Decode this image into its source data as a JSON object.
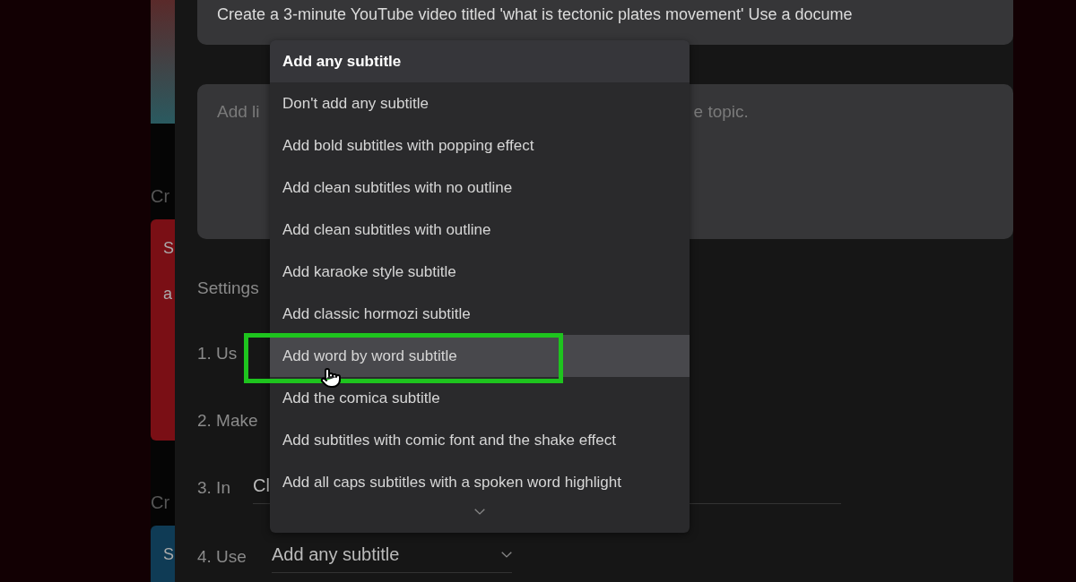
{
  "background_page": {
    "sidebar_texts": [
      "Cr",
      "Cr"
    ],
    "red_card": [
      "S",
      "a"
    ],
    "blue_card": [
      "S"
    ]
  },
  "prompt": {
    "value": "Create a 3-minute YouTube video titled 'what is tectonic plates movement' Use a docume"
  },
  "links_field": {
    "placeholder_start": "Add li",
    "placeholder_end": "e topic."
  },
  "settings": {
    "title": "Settings",
    "steps": [
      {
        "label": "1. Us"
      },
      {
        "label": "2. Make"
      },
      {
        "label": "3. In",
        "value": "Cl"
      },
      {
        "label": "4. Use",
        "value": "Add any subtitle"
      }
    ]
  },
  "subtitle_menu": {
    "items": [
      {
        "label": "Add any subtitle",
        "selected": true,
        "hovered": false
      },
      {
        "label": "Don't add any subtitle",
        "selected": false,
        "hovered": false
      },
      {
        "label": "Add bold subtitles with popping effect",
        "selected": false,
        "hovered": false
      },
      {
        "label": "Add clean subtitles with no outline",
        "selected": false,
        "hovered": false
      },
      {
        "label": "Add clean subtitles with outline",
        "selected": false,
        "hovered": false
      },
      {
        "label": "Add karaoke style subtitle",
        "selected": false,
        "hovered": false
      },
      {
        "label": "Add classic hormozi subtitle",
        "selected": false,
        "hovered": false
      },
      {
        "label": "Add word by word subtitle",
        "selected": false,
        "hovered": true
      },
      {
        "label": "Add the comica subtitle",
        "selected": false,
        "hovered": false
      },
      {
        "label": "Add subtitles with comic font and the shake effect",
        "selected": false,
        "hovered": false
      },
      {
        "label": "Add all caps subtitles with a spoken word highlight",
        "selected": false,
        "hovered": false
      }
    ]
  }
}
